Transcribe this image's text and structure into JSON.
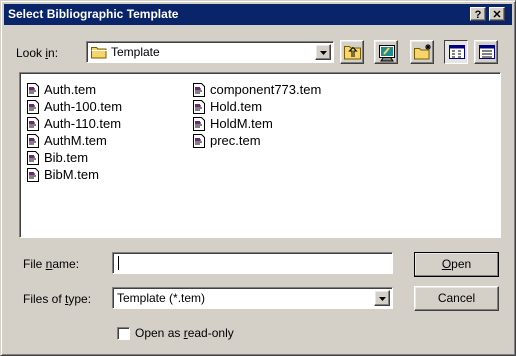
{
  "dialog": {
    "title": "Select Bibliographic Template",
    "help_button": "?",
    "close_button": "✕"
  },
  "lookin": {
    "label": "Look in:",
    "value": "Template"
  },
  "toolbar": {
    "icons": [
      "up-one-level-icon",
      "desktop-icon",
      "new-folder-icon",
      "list-view-icon",
      "details-view-icon"
    ]
  },
  "files": {
    "column1": [
      "Auth.tem",
      "Auth-100.tem",
      "Auth-110.tem",
      "AuthM.tem",
      "Bib.tem",
      "BibM.tem"
    ],
    "column2": [
      "component773.tem",
      "Hold.tem",
      "HoldM.tem",
      "prec.tem"
    ]
  },
  "filename": {
    "label": "File name:",
    "value": ""
  },
  "filetype": {
    "label": "Files of type:",
    "value": "Template (*.tem)"
  },
  "buttons": {
    "open": "Open",
    "cancel": "Cancel"
  },
  "readonly": {
    "label": "Open as read-only",
    "checked": false
  },
  "colors": {
    "titlebar": "#0a246a",
    "face": "#d4d0c8",
    "folder": "#f6d66b"
  }
}
